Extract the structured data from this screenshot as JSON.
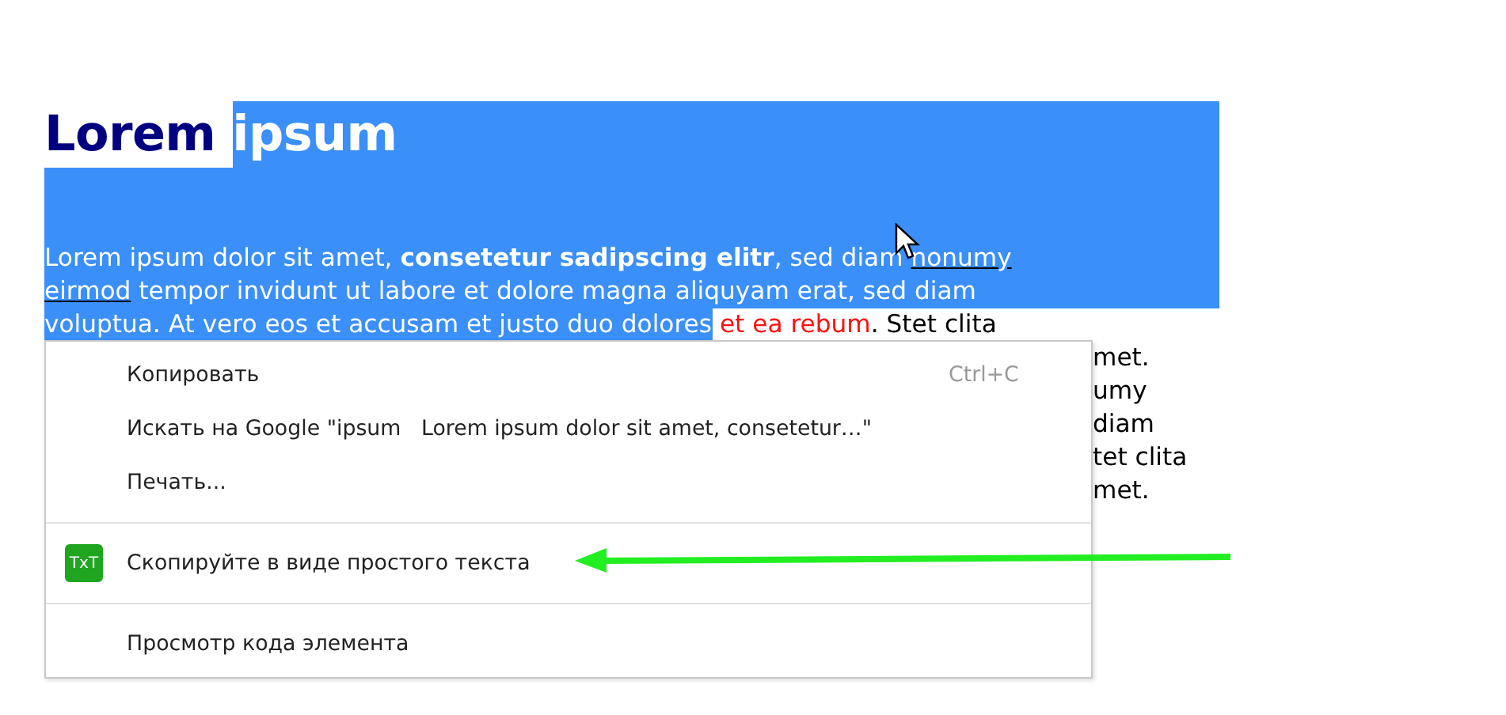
{
  "heading": [
    {
      "text": "Lorem ",
      "selected": false
    },
    {
      "text": "ipsum",
      "selected": true
    }
  ],
  "margin_selected": true,
  "paragraph_lines": [
    [
      {
        "text": "Lorem ipsum dolor sit amet, ",
        "kind": "plain",
        "selected": true
      },
      {
        "text": "consetetur sadipscing elitr",
        "kind": "bold",
        "selected": true
      },
      {
        "text": ", sed diam ",
        "kind": "plain",
        "selected": true
      },
      {
        "text": "nonumy",
        "kind": "link",
        "selected": true
      }
    ],
    [
      {
        "text": "eirmod",
        "kind": "link",
        "selected": true
      },
      {
        "text": " tempor invidunt ut labore et dolore magna aliquyam erat, sed diam",
        "kind": "plain",
        "selected": true
      }
    ],
    [
      {
        "text": "voluptua. At vero eos et accusam et justo duo dolores",
        "kind": "plain",
        "selected": true
      },
      {
        "text": " et ea rebum",
        "kind": "red",
        "selected": false
      },
      {
        "text": ". Stet clita",
        "kind": "plain",
        "selected": false
      }
    ]
  ],
  "paragraph_fragments": [
    "met.",
    "umy",
    "diam",
    "tet clita",
    "met."
  ],
  "context_menu": [
    {
      "kind": "item",
      "label": "Копировать",
      "shortcut": "Ctrl+C"
    },
    {
      "kind": "item",
      "label": "Искать на Google \"ipsum   Lorem ipsum dolor sit amet, consetetur…\""
    },
    {
      "kind": "item",
      "label": "Печать..."
    },
    {
      "kind": "separator"
    },
    {
      "kind": "item",
      "label": "Скопируйте в виде простого текста",
      "icon": "TxT"
    },
    {
      "kind": "separator"
    },
    {
      "kind": "item",
      "label": "Просмотр кода элемента"
    }
  ]
}
